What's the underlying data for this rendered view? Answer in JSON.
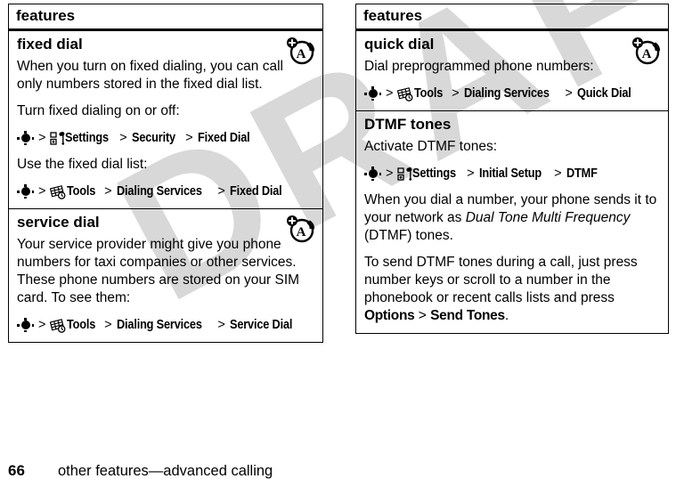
{
  "document": {
    "watermark": "DRAFT",
    "footer": {
      "page_number": "66",
      "chapter_title": "other features—advanced calling"
    }
  },
  "columns": [
    {
      "name": "left-column",
      "table_header": "features",
      "sections": [
        {
          "title": "fixed dial",
          "badge_icon": "network-subscription-icon",
          "blocks": [
            {
              "type": "paragraph",
              "text": "When you turn on fixed dialing, you can call only numbers stored in the fixed dial list."
            },
            {
              "type": "paragraph",
              "text": "Turn fixed dialing on or off:"
            },
            {
              "type": "navpath",
              "nav_icon": "nav-center-key-icon",
              "menu_icon": "settings-toolbox-icon",
              "steps": [
                "Settings",
                "Security",
                "Fixed Dial"
              ]
            },
            {
              "type": "paragraph",
              "text": "Use the fixed dial list:"
            },
            {
              "type": "navpath",
              "nav_icon": "nav-center-key-icon",
              "menu_icon": "tools-icon",
              "steps": [
                "Tools",
                "Dialing Services",
                "Fixed Dial"
              ]
            }
          ]
        },
        {
          "title": "service dial",
          "badge_icon": "network-subscription-icon",
          "blocks": [
            {
              "type": "paragraph",
              "text": "Your service provider might give you phone numbers for taxi companies or other services. These phone numbers are stored on your SIM card. To see them:"
            },
            {
              "type": "navpath",
              "nav_icon": "nav-center-key-icon",
              "menu_icon": "tools-icon",
              "steps": [
                "Tools",
                "Dialing Services",
                "Service Dial"
              ]
            }
          ]
        }
      ]
    },
    {
      "name": "right-column",
      "table_header": "features",
      "sections": [
        {
          "title": "quick dial",
          "badge_icon": "network-subscription-icon",
          "blocks": [
            {
              "type": "paragraph",
              "text": "Dial preprogrammed phone numbers:"
            },
            {
              "type": "navpath",
              "nav_icon": "nav-center-key-icon",
              "menu_icon": "tools-icon",
              "steps": [
                "Tools",
                "Dialing Services",
                "Quick Dial"
              ]
            }
          ]
        },
        {
          "title": "DTMF tones",
          "badge_icon": null,
          "blocks": [
            {
              "type": "paragraph",
              "text": "Activate DTMF tones:"
            },
            {
              "type": "navpath",
              "nav_icon": "nav-center-key-icon",
              "menu_icon": "settings-toolbox-icon",
              "steps": [
                "Settings",
                "Initial Setup",
                "DTMF"
              ]
            },
            {
              "type": "paragraph_rich",
              "parts": [
                {
                  "text": "When you dial a number, your phone sends it to your network as ",
                  "style": "normal"
                },
                {
                  "text": "Dual Tone Multi Frequency",
                  "style": "italic"
                },
                {
                  "text": " (DTMF) tones.",
                  "style": "normal"
                }
              ]
            },
            {
              "type": "paragraph_rich",
              "parts": [
                {
                  "text": "To send DTMF tones during a call, just press number keys or scroll to a number in the phonebook or recent calls lists and press ",
                  "style": "normal"
                },
                {
                  "text": "Options",
                  "style": "bold-condensed"
                },
                {
                  "text": " > ",
                  "style": "normal"
                },
                {
                  "text": "Send Tones",
                  "style": "bold-condensed"
                },
                {
                  "text": ".",
                  "style": "normal"
                }
              ]
            }
          ]
        }
      ]
    }
  ],
  "colors": {
    "text": "#000000",
    "rule": "#000000",
    "watermark": "#d8d8d8",
    "page_background": "#ffffff"
  }
}
